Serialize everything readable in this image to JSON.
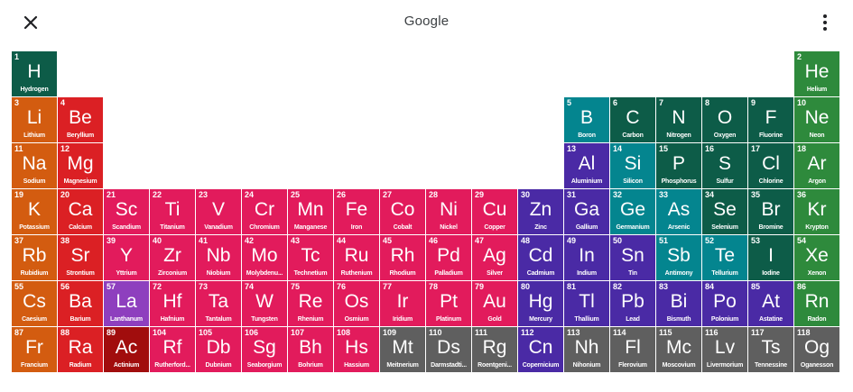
{
  "header": {
    "title": "Google"
  },
  "colors": {
    "nonmetal": "#0d5c48",
    "noble": "#2e8a3c",
    "alkali": "#d35c10",
    "alkaline": "#db2024",
    "transition": "#e21b5c",
    "metalloid": "#04858f",
    "post_transition": "#4a2aa5",
    "unknown": "#5f5f5f",
    "lanthanide": "#8e3fbe",
    "actinide": "#a10d0d"
  },
  "elements": [
    {
      "n": "1",
      "s": "H",
      "name": "Hydrogen",
      "c": "nonmetal",
      "row": 1,
      "col": 1
    },
    {
      "n": "2",
      "s": "He",
      "name": "Helium",
      "c": "noble",
      "row": 1,
      "col": 18
    },
    {
      "n": "3",
      "s": "Li",
      "name": "Lithium",
      "c": "alkali",
      "row": 2,
      "col": 1
    },
    {
      "n": "4",
      "s": "Be",
      "name": "Beryllium",
      "c": "alkaline",
      "row": 2,
      "col": 2
    },
    {
      "n": "5",
      "s": "B",
      "name": "Boron",
      "c": "metalloid",
      "row": 2,
      "col": 13
    },
    {
      "n": "6",
      "s": "C",
      "name": "Carbon",
      "c": "nonmetal",
      "row": 2,
      "col": 14
    },
    {
      "n": "7",
      "s": "N",
      "name": "Nitrogen",
      "c": "nonmetal",
      "row": 2,
      "col": 15
    },
    {
      "n": "8",
      "s": "O",
      "name": "Oxygen",
      "c": "nonmetal",
      "row": 2,
      "col": 16
    },
    {
      "n": "9",
      "s": "F",
      "name": "Fluorine",
      "c": "nonmetal",
      "row": 2,
      "col": 17
    },
    {
      "n": "10",
      "s": "Ne",
      "name": "Neon",
      "c": "noble",
      "row": 2,
      "col": 18
    },
    {
      "n": "11",
      "s": "Na",
      "name": "Sodium",
      "c": "alkali",
      "row": 3,
      "col": 1
    },
    {
      "n": "12",
      "s": "Mg",
      "name": "Magnesium",
      "c": "alkaline",
      "row": 3,
      "col": 2
    },
    {
      "n": "13",
      "s": "Al",
      "name": "Aluminium",
      "c": "post_transition",
      "row": 3,
      "col": 13
    },
    {
      "n": "14",
      "s": "Si",
      "name": "Silicon",
      "c": "metalloid",
      "row": 3,
      "col": 14
    },
    {
      "n": "15",
      "s": "P",
      "name": "Phosphorus",
      "c": "nonmetal",
      "row": 3,
      "col": 15
    },
    {
      "n": "16",
      "s": "S",
      "name": "Sulfur",
      "c": "nonmetal",
      "row": 3,
      "col": 16
    },
    {
      "n": "17",
      "s": "Cl",
      "name": "Chlorine",
      "c": "nonmetal",
      "row": 3,
      "col": 17
    },
    {
      "n": "18",
      "s": "Ar",
      "name": "Argon",
      "c": "noble",
      "row": 3,
      "col": 18
    },
    {
      "n": "19",
      "s": "K",
      "name": "Potassium",
      "c": "alkali",
      "row": 4,
      "col": 1
    },
    {
      "n": "20",
      "s": "Ca",
      "name": "Calcium",
      "c": "alkaline",
      "row": 4,
      "col": 2
    },
    {
      "n": "21",
      "s": "Sc",
      "name": "Scandium",
      "c": "transition",
      "row": 4,
      "col": 3
    },
    {
      "n": "22",
      "s": "Ti",
      "name": "Titanium",
      "c": "transition",
      "row": 4,
      "col": 4
    },
    {
      "n": "23",
      "s": "V",
      "name": "Vanadium",
      "c": "transition",
      "row": 4,
      "col": 5
    },
    {
      "n": "24",
      "s": "Cr",
      "name": "Chromium",
      "c": "transition",
      "row": 4,
      "col": 6
    },
    {
      "n": "25",
      "s": "Mn",
      "name": "Manganese",
      "c": "transition",
      "row": 4,
      "col": 7
    },
    {
      "n": "26",
      "s": "Fe",
      "name": "Iron",
      "c": "transition",
      "row": 4,
      "col": 8
    },
    {
      "n": "27",
      "s": "Co",
      "name": "Cobalt",
      "c": "transition",
      "row": 4,
      "col": 9
    },
    {
      "n": "28",
      "s": "Ni",
      "name": "Nickel",
      "c": "transition",
      "row": 4,
      "col": 10
    },
    {
      "n": "29",
      "s": "Cu",
      "name": "Copper",
      "c": "transition",
      "row": 4,
      "col": 11
    },
    {
      "n": "30",
      "s": "Zn",
      "name": "Zinc",
      "c": "post_transition",
      "row": 4,
      "col": 12
    },
    {
      "n": "31",
      "s": "Ga",
      "name": "Gallium",
      "c": "post_transition",
      "row": 4,
      "col": 13
    },
    {
      "n": "32",
      "s": "Ge",
      "name": "Germanium",
      "c": "metalloid",
      "row": 4,
      "col": 14
    },
    {
      "n": "33",
      "s": "As",
      "name": "Arsenic",
      "c": "metalloid",
      "row": 4,
      "col": 15
    },
    {
      "n": "34",
      "s": "Se",
      "name": "Selenium",
      "c": "nonmetal",
      "row": 4,
      "col": 16
    },
    {
      "n": "35",
      "s": "Br",
      "name": "Bromine",
      "c": "nonmetal",
      "row": 4,
      "col": 17
    },
    {
      "n": "36",
      "s": "Kr",
      "name": "Krypton",
      "c": "noble",
      "row": 4,
      "col": 18
    },
    {
      "n": "37",
      "s": "Rb",
      "name": "Rubidium",
      "c": "alkali",
      "row": 5,
      "col": 1
    },
    {
      "n": "38",
      "s": "Sr",
      "name": "Strontium",
      "c": "alkaline",
      "row": 5,
      "col": 2
    },
    {
      "n": "39",
      "s": "Y",
      "name": "Yttrium",
      "c": "transition",
      "row": 5,
      "col": 3
    },
    {
      "n": "40",
      "s": "Zr",
      "name": "Zirconium",
      "c": "transition",
      "row": 5,
      "col": 4
    },
    {
      "n": "41",
      "s": "Nb",
      "name": "Niobium",
      "c": "transition",
      "row": 5,
      "col": 5
    },
    {
      "n": "42",
      "s": "Mo",
      "name": "Molybdenu...",
      "c": "transition",
      "row": 5,
      "col": 6
    },
    {
      "n": "43",
      "s": "Tc",
      "name": "Technetium",
      "c": "transition",
      "row": 5,
      "col": 7
    },
    {
      "n": "44",
      "s": "Ru",
      "name": "Ruthenium",
      "c": "transition",
      "row": 5,
      "col": 8
    },
    {
      "n": "45",
      "s": "Rh",
      "name": "Rhodium",
      "c": "transition",
      "row": 5,
      "col": 9
    },
    {
      "n": "46",
      "s": "Pd",
      "name": "Palladium",
      "c": "transition",
      "row": 5,
      "col": 10
    },
    {
      "n": "47",
      "s": "Ag",
      "name": "Silver",
      "c": "transition",
      "row": 5,
      "col": 11
    },
    {
      "n": "48",
      "s": "Cd",
      "name": "Cadmium",
      "c": "post_transition",
      "row": 5,
      "col": 12
    },
    {
      "n": "49",
      "s": "In",
      "name": "Indium",
      "c": "post_transition",
      "row": 5,
      "col": 13
    },
    {
      "n": "50",
      "s": "Sn",
      "name": "Tin",
      "c": "post_transition",
      "row": 5,
      "col": 14
    },
    {
      "n": "51",
      "s": "Sb",
      "name": "Antimony",
      "c": "metalloid",
      "row": 5,
      "col": 15
    },
    {
      "n": "52",
      "s": "Te",
      "name": "Tellurium",
      "c": "metalloid",
      "row": 5,
      "col": 16
    },
    {
      "n": "53",
      "s": "I",
      "name": "Iodine",
      "c": "nonmetal",
      "row": 5,
      "col": 17
    },
    {
      "n": "54",
      "s": "Xe",
      "name": "Xenon",
      "c": "noble",
      "row": 5,
      "col": 18
    },
    {
      "n": "55",
      "s": "Cs",
      "name": "Caesium",
      "c": "alkali",
      "row": 6,
      "col": 1
    },
    {
      "n": "56",
      "s": "Ba",
      "name": "Barium",
      "c": "alkaline",
      "row": 6,
      "col": 2
    },
    {
      "n": "57",
      "s": "La",
      "name": "Lanthanum",
      "c": "lanthanide",
      "row": 6,
      "col": 3
    },
    {
      "n": "72",
      "s": "Hf",
      "name": "Hafnium",
      "c": "transition",
      "row": 6,
      "col": 4
    },
    {
      "n": "73",
      "s": "Ta",
      "name": "Tantalum",
      "c": "transition",
      "row": 6,
      "col": 5
    },
    {
      "n": "74",
      "s": "W",
      "name": "Tungsten",
      "c": "transition",
      "row": 6,
      "col": 6
    },
    {
      "n": "75",
      "s": "Re",
      "name": "Rhenium",
      "c": "transition",
      "row": 6,
      "col": 7
    },
    {
      "n": "76",
      "s": "Os",
      "name": "Osmium",
      "c": "transition",
      "row": 6,
      "col": 8
    },
    {
      "n": "77",
      "s": "Ir",
      "name": "Iridium",
      "c": "transition",
      "row": 6,
      "col": 9
    },
    {
      "n": "78",
      "s": "Pt",
      "name": "Platinum",
      "c": "transition",
      "row": 6,
      "col": 10
    },
    {
      "n": "79",
      "s": "Au",
      "name": "Gold",
      "c": "transition",
      "row": 6,
      "col": 11
    },
    {
      "n": "80",
      "s": "Hg",
      "name": "Mercury",
      "c": "post_transition",
      "row": 6,
      "col": 12
    },
    {
      "n": "81",
      "s": "Tl",
      "name": "Thallium",
      "c": "post_transition",
      "row": 6,
      "col": 13
    },
    {
      "n": "82",
      "s": "Pb",
      "name": "Lead",
      "c": "post_transition",
      "row": 6,
      "col": 14
    },
    {
      "n": "83",
      "s": "Bi",
      "name": "Bismuth",
      "c": "post_transition",
      "row": 6,
      "col": 15
    },
    {
      "n": "84",
      "s": "Po",
      "name": "Polonium",
      "c": "post_transition",
      "row": 6,
      "col": 16
    },
    {
      "n": "85",
      "s": "At",
      "name": "Astatine",
      "c": "post_transition",
      "row": 6,
      "col": 17
    },
    {
      "n": "86",
      "s": "Rn",
      "name": "Radon",
      "c": "noble",
      "row": 6,
      "col": 18
    },
    {
      "n": "87",
      "s": "Fr",
      "name": "Francium",
      "c": "alkali",
      "row": 7,
      "col": 1
    },
    {
      "n": "88",
      "s": "Ra",
      "name": "Radium",
      "c": "alkaline",
      "row": 7,
      "col": 2
    },
    {
      "n": "89",
      "s": "Ac",
      "name": "Actinium",
      "c": "actinide",
      "row": 7,
      "col": 3
    },
    {
      "n": "104",
      "s": "Rf",
      "name": "Rutherford...",
      "c": "transition",
      "row": 7,
      "col": 4
    },
    {
      "n": "105",
      "s": "Db",
      "name": "Dubnium",
      "c": "transition",
      "row": 7,
      "col": 5
    },
    {
      "n": "106",
      "s": "Sg",
      "name": "Seaborgium",
      "c": "transition",
      "row": 7,
      "col": 6
    },
    {
      "n": "107",
      "s": "Bh",
      "name": "Bohrium",
      "c": "transition",
      "row": 7,
      "col": 7
    },
    {
      "n": "108",
      "s": "Hs",
      "name": "Hassium",
      "c": "transition",
      "row": 7,
      "col": 8
    },
    {
      "n": "109",
      "s": "Mt",
      "name": "Meitnerium",
      "c": "unknown",
      "row": 7,
      "col": 9
    },
    {
      "n": "110",
      "s": "Ds",
      "name": "Darmstadti...",
      "c": "unknown",
      "row": 7,
      "col": 10
    },
    {
      "n": "111",
      "s": "Rg",
      "name": "Roentgeni...",
      "c": "unknown",
      "row": 7,
      "col": 11
    },
    {
      "n": "112",
      "s": "Cn",
      "name": "Copernicium",
      "c": "post_transition",
      "row": 7,
      "col": 12
    },
    {
      "n": "113",
      "s": "Nh",
      "name": "Nihonium",
      "c": "unknown",
      "row": 7,
      "col": 13
    },
    {
      "n": "114",
      "s": "Fl",
      "name": "Flerovium",
      "c": "unknown",
      "row": 7,
      "col": 14
    },
    {
      "n": "115",
      "s": "Mc",
      "name": "Moscovium",
      "c": "unknown",
      "row": 7,
      "col": 15
    },
    {
      "n": "116",
      "s": "Lv",
      "name": "Livermorium",
      "c": "unknown",
      "row": 7,
      "col": 16
    },
    {
      "n": "117",
      "s": "Ts",
      "name": "Tennessine",
      "c": "unknown",
      "row": 7,
      "col": 17
    },
    {
      "n": "118",
      "s": "Og",
      "name": "Oganesson",
      "c": "unknown",
      "row": 7,
      "col": 18
    }
  ]
}
